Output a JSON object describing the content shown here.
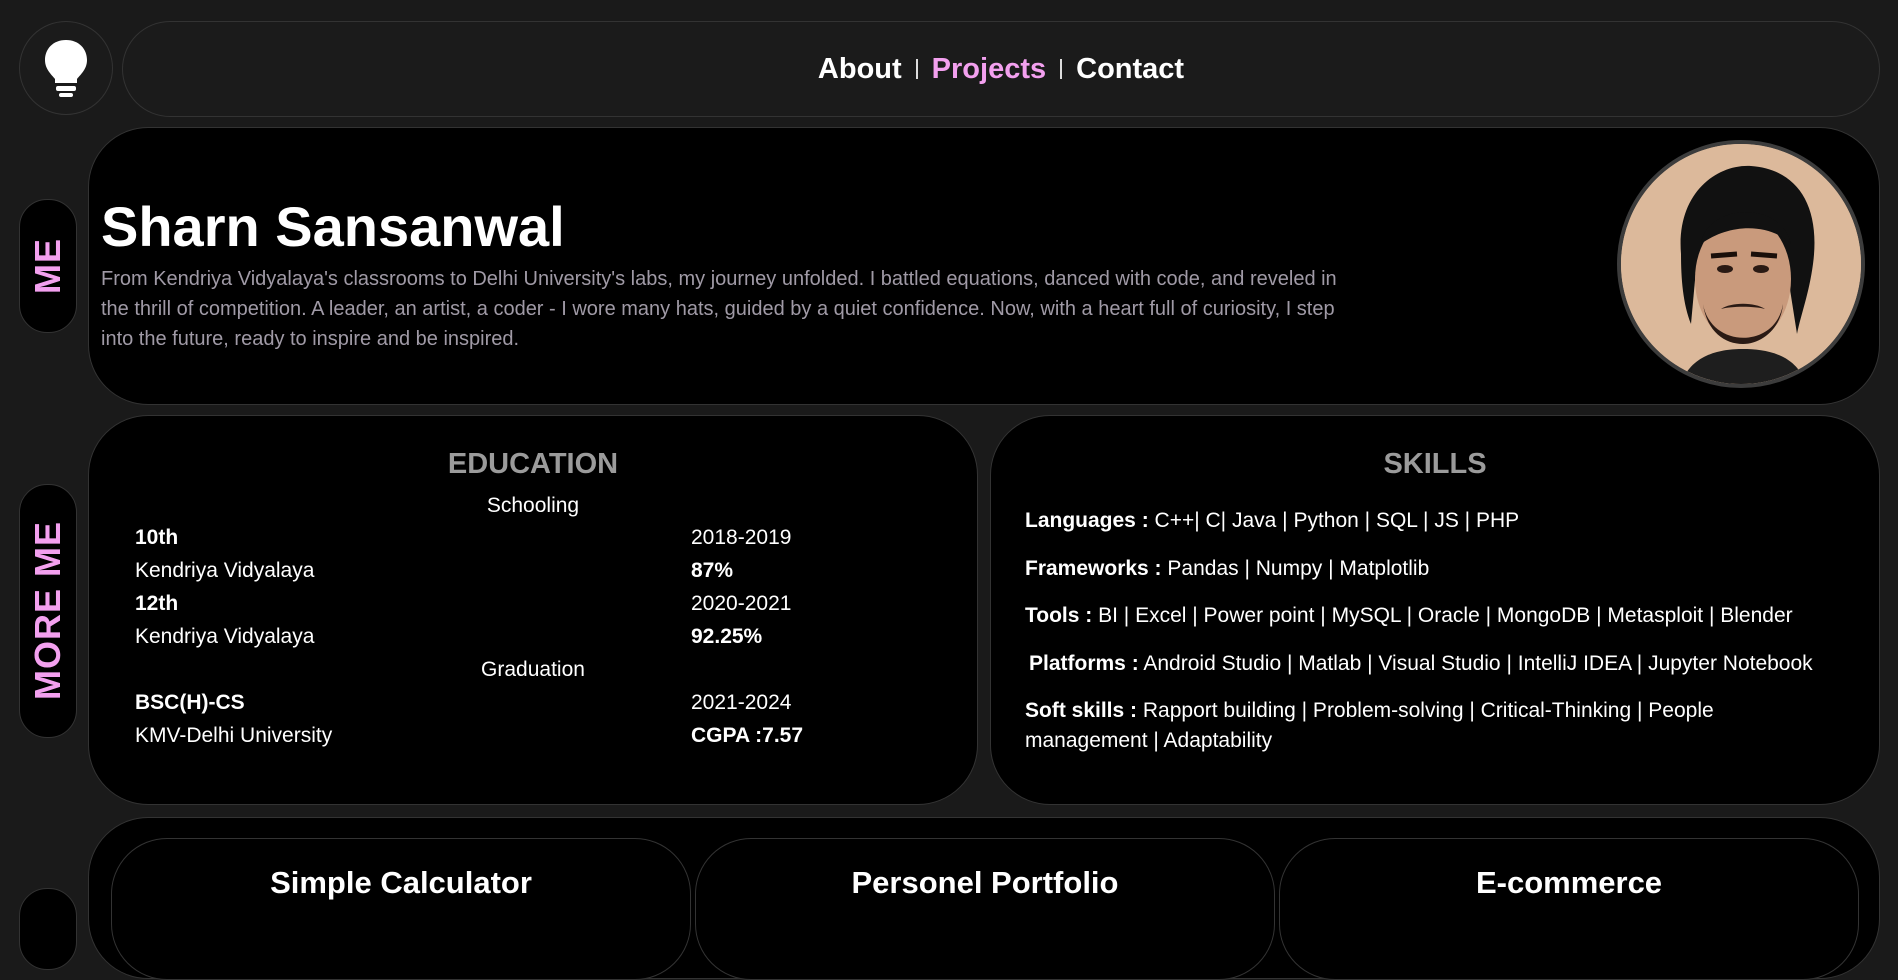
{
  "logo": {
    "icon": "lightbulb-icon"
  },
  "nav": {
    "items": [
      {
        "label": "About"
      },
      {
        "label": "Projects"
      },
      {
        "label": "Contact"
      }
    ],
    "active": "Projects",
    "accent_color": "#f3a0ef"
  },
  "side_labels": {
    "me": "ME",
    "more_me": "MORE ME"
  },
  "hero": {
    "name": "Sharn Sansanwal",
    "bio": "From Kendriya Vidyalaya's classrooms to Delhi University's labs, my journey unfolded. I battled equations, danced with code, and reveled in the thrill of competition. A leader, an artist, a coder - I wore many hats, guided by a quiet confidence. Now, with a heart full of curiosity, I step into the future, ready to inspire and be inspired."
  },
  "education": {
    "title": "EDUCATION",
    "schooling_label": "Schooling",
    "graduation_label": "Graduation",
    "entries": [
      {
        "level": "10th",
        "years": "2018-2019",
        "institution": "Kendriya Vidyalaya",
        "score": "87%"
      },
      {
        "level": "12th",
        "years": "2020-2021",
        "institution": "Kendriya Vidyalaya",
        "score": "92.25%"
      },
      {
        "level": "BSC(H)-CS",
        "years": "2021-2024",
        "institution": "KMV-Delhi University",
        "score": "CGPA :7.57"
      }
    ]
  },
  "skills": {
    "title": "SKILLS",
    "items": [
      {
        "label": "Languages :",
        "value": "C++| C| Java | Python | SQL | JS | PHP"
      },
      {
        "label": "Frameworks :",
        "value": "Pandas | Numpy | Matplotlib"
      },
      {
        "label": "Tools :",
        "value": "BI | Excel | Power point | MySQL | Oracle | MongoDB | Metasploit | Blender"
      },
      {
        "label": "Platforms :",
        "value": "Android Studio | Matlab | Visual Studio | IntelliJ IDEA | Jupyter Notebook"
      },
      {
        "label": "Soft skills :",
        "value": "Rapport building | Problem-solving | Critical-Thinking | People management | Adaptability"
      }
    ]
  },
  "projects": [
    {
      "title": "Simple Calculator"
    },
    {
      "title": "Personel Portfolio"
    },
    {
      "title": "E-commerce"
    }
  ]
}
